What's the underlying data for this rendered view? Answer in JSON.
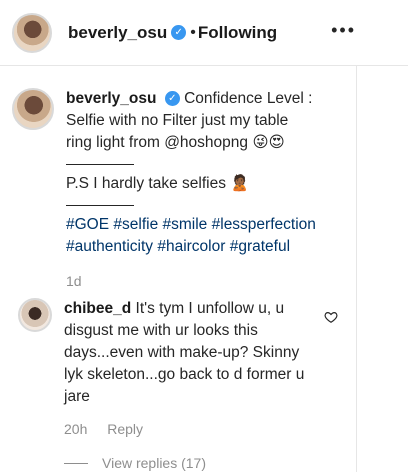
{
  "header": {
    "username": "beverly_osu",
    "dot": "•",
    "following": "Following",
    "more": "•••"
  },
  "post": {
    "username": "beverly_osu",
    "caption_line1": "Confidence Level :",
    "caption_line2": "Selfie with no Filter just my table",
    "caption_line3": "ring light from @hoshopng 😜😍",
    "ps": "P.S I hardly take selfies 🙎🏾",
    "hashtags": [
      "#GOE",
      "#selfie",
      "#smile",
      "#lessperfection",
      "#authenticity",
      "#haircolor",
      "#grateful"
    ],
    "age": "1d"
  },
  "comment": {
    "username": "chibee_d",
    "text": "It's tym I unfollow u, u disgust me with ur looks this days...even with make-up? Skinny lyk skeleton...go back to d former u jare",
    "age": "20h",
    "reply": "Reply",
    "view_replies": "View replies (17)"
  },
  "icons": {
    "verified": "verified-badge-icon",
    "more": "more-options-icon",
    "heart": "heart-outline-icon"
  },
  "colors": {
    "verified": "#3897f0",
    "hashtag": "#003569",
    "muted": "#8e8e8e"
  }
}
